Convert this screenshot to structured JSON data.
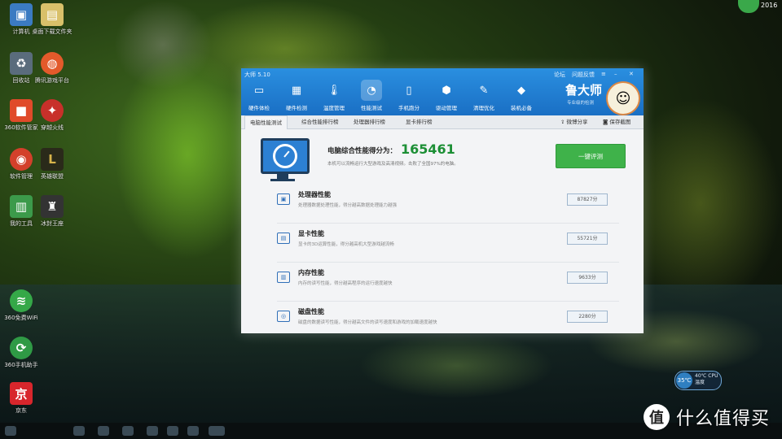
{
  "desktop": {
    "icons": [
      {
        "label": "计算机",
        "icon": "computer-icon"
      },
      {
        "label": "回收站",
        "icon": "recycle-bin-icon"
      },
      {
        "label": "360软件管家",
        "icon": "software-manager-icon"
      },
      {
        "label": "软件管理",
        "icon": "app-icon"
      },
      {
        "label": "我的工具",
        "icon": "tools-icon"
      },
      {
        "label": "360免费WiFi",
        "icon": "wifi-icon"
      },
      {
        "label": "360手机助手",
        "icon": "phone-assistant-icon"
      },
      {
        "label": "京东",
        "icon": "jd-icon"
      },
      {
        "label": "桌面下载文件夹",
        "icon": "folder-icon"
      },
      {
        "label": "腾讯游戏平台",
        "icon": "game-platform-icon"
      },
      {
        "label": "穿越火线",
        "icon": "game-icon"
      },
      {
        "label": "英雄联盟",
        "icon": "lol-icon"
      },
      {
        "label": "冰封王座",
        "icon": "warcraft-icon"
      }
    ]
  },
  "window": {
    "title": "大师 5.10",
    "controls": [
      "论坛",
      "问题反馈"
    ],
    "nav": [
      {
        "label": "硬件体检",
        "icon": "monitor-icon"
      },
      {
        "label": "硬件检测",
        "icon": "chip-icon"
      },
      {
        "label": "温度管理",
        "icon": "thermometer-icon"
      },
      {
        "label": "性能测试",
        "icon": "speedometer-icon"
      },
      {
        "label": "手机跑分",
        "icon": "phone-icon"
      },
      {
        "label": "驱动管理",
        "icon": "driver-icon"
      },
      {
        "label": "清理优化",
        "icon": "broom-icon"
      },
      {
        "label": "装机必备",
        "icon": "cube-icon"
      }
    ],
    "brand": "鲁大师",
    "brand_sub": "专业级的检测"
  },
  "tabs": [
    "电脑性能测试",
    "综合性能排行榜",
    "处理器排行榜",
    "显卡排行榜"
  ],
  "tab_actions": {
    "share": "微博分享",
    "save": "保存截图"
  },
  "summary": {
    "title": "电脑综合性能得分为：",
    "score": "165461",
    "desc": "本机可以流畅运行大型游戏及高清视频。击败了全国97%的电脑。",
    "button": "一键评测"
  },
  "performance": [
    {
      "title": "处理器性能",
      "desc": "处理器数据处理性能，得分越高数据处理能力越强",
      "score": "87827分",
      "icon": "cpu-icon"
    },
    {
      "title": "显卡性能",
      "desc": "显卡的3D运算性能，得分越高机大型游戏越流畅",
      "score": "55721分",
      "icon": "gpu-icon"
    },
    {
      "title": "内存性能",
      "desc": "内存的读写性能，得分越高程序的运行速度越快",
      "score": "9633分",
      "icon": "memory-icon"
    },
    {
      "title": "磁盘性能",
      "desc": "磁盘的数据读写性能，得分越高文件的读写速度和游戏的加载速度越快",
      "score": "2280分",
      "icon": "disk-icon"
    }
  ],
  "tray": {
    "text": "2016"
  },
  "temp": {
    "value": "35℃",
    "label": "40℃ CPU温度"
  },
  "watermark": {
    "logo": "值",
    "text": "什么值得买"
  }
}
